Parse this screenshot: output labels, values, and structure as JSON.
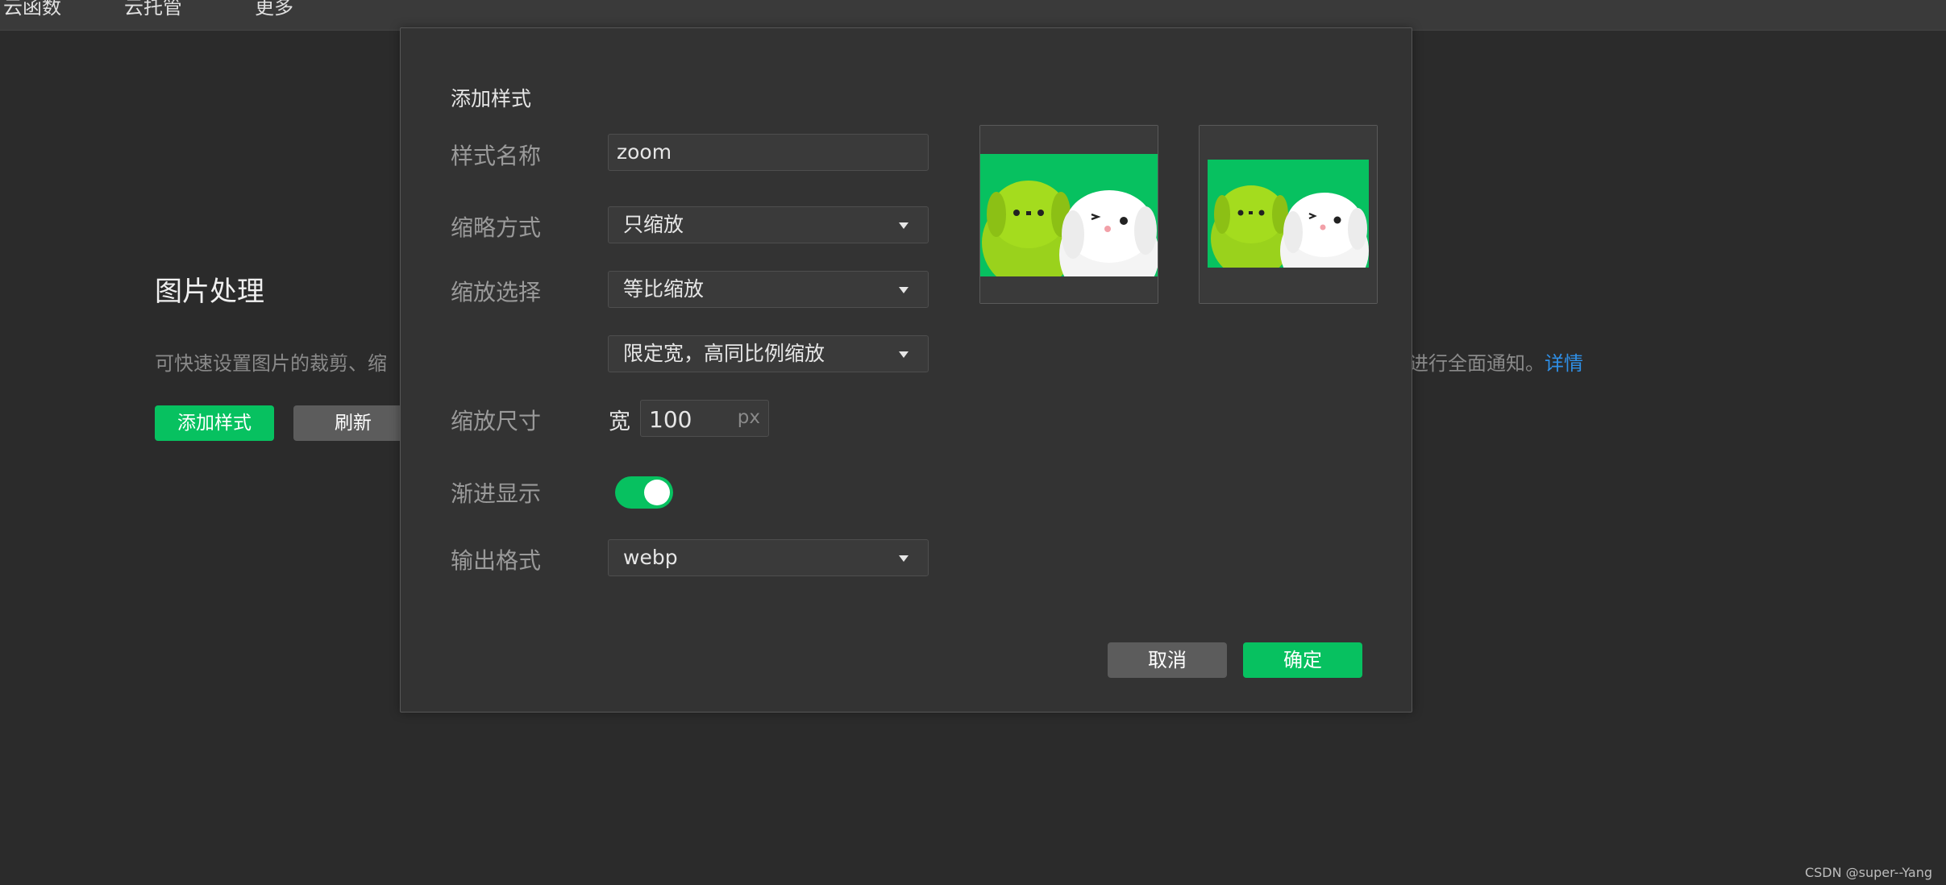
{
  "topnav": {
    "items": [
      "云函数",
      "云托管",
      "更多"
    ]
  },
  "page": {
    "title": "图片处理",
    "description": "可快速设置图片的裁剪、缩",
    "description_tail": "进行全面通知。",
    "details_link": "详情",
    "add_style_button": "添加样式",
    "refresh_button": "刷新"
  },
  "modal": {
    "title": "添加样式",
    "style_name": {
      "label": "样式名称",
      "value": "zoom"
    },
    "thumbnail_mode": {
      "label": "缩略方式",
      "value": "只缩放"
    },
    "scale_select": {
      "label": "缩放选择",
      "value": "等比缩放"
    },
    "scale_sub": {
      "value": "限定宽，高同比例缩放"
    },
    "scale_size": {
      "label": "缩放尺寸",
      "prefix": "宽",
      "value": "100",
      "unit": "px"
    },
    "progressive": {
      "label": "渐进显示",
      "enabled": true
    },
    "output_format": {
      "label": "输出格式",
      "value": "webp"
    },
    "cancel_button": "取消",
    "confirm_button": "确定"
  },
  "colors": {
    "accent": "#07c160",
    "link": "#2f8fe6",
    "background": "#2b2b2b",
    "modal_bg": "#333333"
  },
  "watermark": "CSDN @super--Yang"
}
